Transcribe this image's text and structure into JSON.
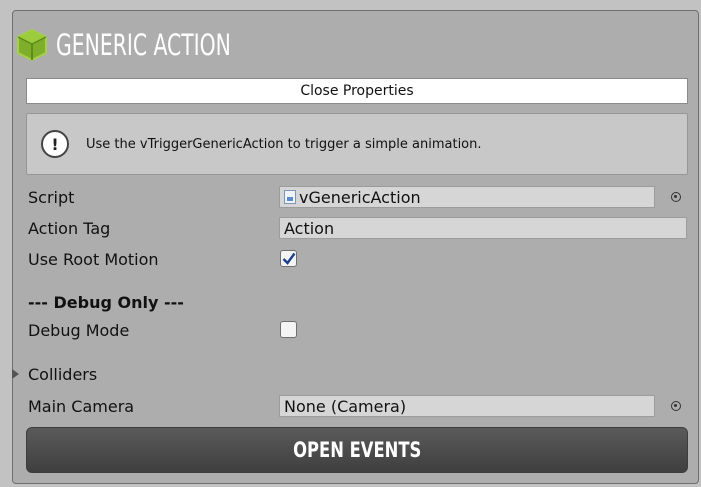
{
  "header": {
    "title": "GENERIC ACTION",
    "logo_icon": "cube-logo-icon"
  },
  "close_button": {
    "label": "Close Properties"
  },
  "help": {
    "icon": "exclamation-icon",
    "text": "Use the vTriggerGenericAction to trigger a simple animation."
  },
  "fields": {
    "script": {
      "label": "Script",
      "value": "vGenericAction"
    },
    "action_tag": {
      "label": "Action Tag",
      "value": "Action"
    },
    "use_root_motion": {
      "label": "Use Root Motion",
      "checked": true
    },
    "debug_section": {
      "title": "--- Debug Only ---"
    },
    "debug_mode": {
      "label": "Debug Mode",
      "checked": false
    },
    "colliders": {
      "label": "Colliders"
    },
    "main_camera": {
      "label": "Main Camera",
      "value": "None (Camera)"
    }
  },
  "open_events_button": {
    "label": "OPEN EVENTS"
  },
  "colors": {
    "panel": "#adadad",
    "field": "#d6d6d6",
    "logo_green": "#8fbf2e",
    "button_dark": "#4a4a4a"
  }
}
